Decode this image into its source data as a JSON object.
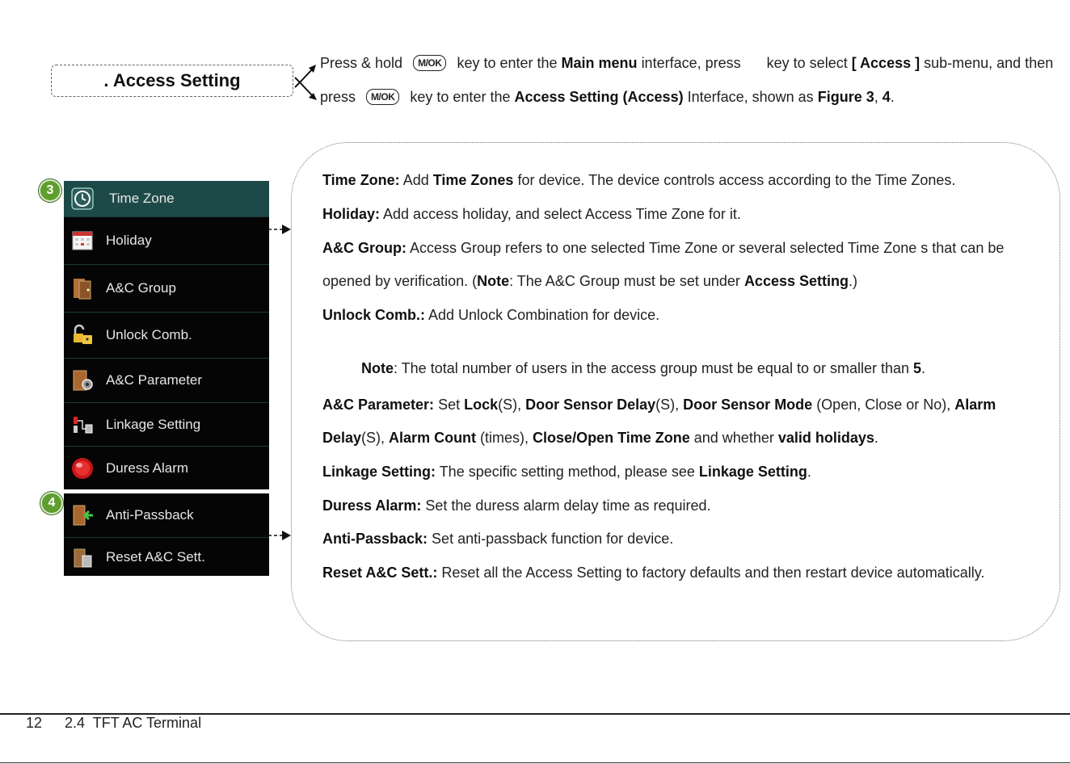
{
  "heading": {
    "label": ". Access Setting"
  },
  "instruction": {
    "line1": {
      "t1": "Press & hold",
      "key": "M/OK",
      "t2": "key to enter the",
      "b1": "Main menu",
      "t3": "interface, press",
      "t4": "key to select",
      "b2": "[ Access ]",
      "t5": "sub-menu, and then"
    },
    "line2": {
      "t1": "press",
      "key": "M/OK",
      "t2": "key to enter the",
      "b1": "Access Setting (Access)",
      "t3": "Interface, shown as",
      "b2": "Figure 3",
      "t4": ",",
      "b3": "4",
      "t5": "."
    }
  },
  "figures": {
    "fig3_badge": "3",
    "fig4_badge": "4"
  },
  "menu_fig3": [
    {
      "label": "Time Zone",
      "icon": "clock-icon",
      "selected": true
    },
    {
      "label": "Holiday",
      "icon": "calendar-icon"
    },
    {
      "label": "A&C Group",
      "icon": "door-group-icon"
    },
    {
      "label": "Unlock Comb.",
      "icon": "unlock-icon"
    },
    {
      "label": "A&C Parameter",
      "icon": "door-gear-icon"
    },
    {
      "label": "Linkage Setting",
      "icon": "linkage-icon"
    },
    {
      "label": "Duress Alarm",
      "icon": "alarm-icon"
    }
  ],
  "menu_fig4": [
    {
      "label": "Anti-Passback",
      "icon": "anti-passback-icon"
    },
    {
      "label": "Reset A&C Sett.",
      "icon": "reset-icon"
    }
  ],
  "descriptions": {
    "time_zone": {
      "b1": "Time Zone:",
      "t1": " Add ",
      "b2": "Time Zones",
      "t2": " for device. The device controls access according to the Time Zones."
    },
    "holiday": {
      "b1": "Holiday:",
      "t1": " Add access holiday, and select Access Time Zone for it."
    },
    "ac_group": {
      "b1": "A&C Group:",
      "t1": " Access Group refers to one selected Time Zone or several selected Time Zone s that can be"
    },
    "ac_group_cont": {
      "t1": "opened by verification. (",
      "b1": "Note",
      "t2": ": The A&C Group must be set under ",
      "b2": "Access Setting",
      "t3": ".)"
    },
    "unlock_comb": {
      "b1": "Unlock Comb.:",
      "t1": " Add Unlock Combination for device."
    },
    "note": {
      "b1": "Note",
      "t1": ": The total number of users in the access group must be equal to or smaller than ",
      "b2": "5",
      "t2": "."
    },
    "ac_param": {
      "b1": "A&C Parameter:",
      "t1": " Set ",
      "b2": "Lock",
      "t2": "(S), ",
      "b3": "Door Sensor Delay",
      "t3": "(S), ",
      "b4": "Door Sensor Mode",
      "t4": " (Open, Close or No), ",
      "b5": "Alarm"
    },
    "ac_param_cont": {
      "b1": "Delay",
      "t1": "(S), ",
      "b2": "Alarm Count",
      "t2": " (times), ",
      "b3": "Close/Open Time Zone",
      "t3": " and whether ",
      "b4": "valid holidays",
      "t4": "."
    },
    "linkage": {
      "b1": "Linkage Setting:",
      "t1": " The specific setting method, please see ",
      "b2": "Linkage Setting",
      "t2": "."
    },
    "duress": {
      "b1": "Duress Alarm:",
      "t1": " Set the duress alarm delay time as required."
    },
    "anti_passback": {
      "b1": "Anti-Passback:",
      "t1": " Set anti-passback function for device."
    },
    "reset": {
      "b1": "Reset A&C Sett.:",
      "t1": " Reset all the Access Setting to factory defaults and then restart device automatically."
    }
  },
  "footer": {
    "page_number": "12",
    "section": "2.4  TFT AC Terminal"
  },
  "colors": {
    "menu_bg": "#050505",
    "menu_selected": "#1d4a48",
    "badge": "#5f9e2e"
  }
}
